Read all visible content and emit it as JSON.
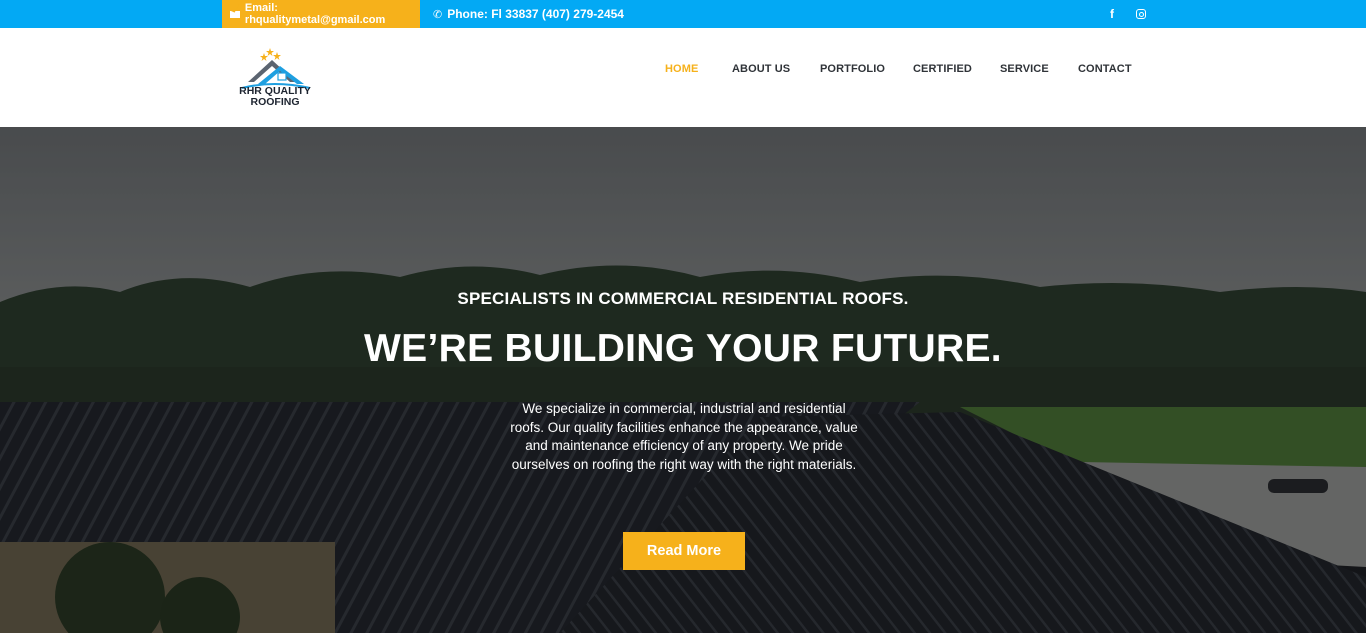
{
  "topbar": {
    "email_text": "Email: rhqualitymetal@gmail.com",
    "phone_text": "Phone: Fl 33837 (407) 279-2454",
    "email_icon": "envelope-icon",
    "phone_icon": "phone-icon",
    "social": [
      {
        "name": "facebook-icon",
        "glyph": "f"
      },
      {
        "name": "instagram-icon",
        "glyph": ""
      }
    ],
    "colors": {
      "bar": "#03a9f4",
      "email_bg": "#f6b11b"
    }
  },
  "header": {
    "logo_line1": "RHR QUALITY",
    "logo_line2": "ROOFING",
    "nav": [
      {
        "label": "HOME",
        "active": true
      },
      {
        "label": "ABOUT US",
        "active": false
      },
      {
        "label": "PORTFOLIO",
        "active": false
      },
      {
        "label": "CERTIFIED",
        "active": false
      },
      {
        "label": "SERVICE",
        "active": false
      },
      {
        "label": "CONTACT",
        "active": false
      }
    ],
    "colors": {
      "active": "#f6b11b",
      "default": "#2f3338"
    }
  },
  "hero": {
    "tagline": "SPECIALISTS IN COMMERCIAL RESIDENTIAL ROOFS.",
    "headline": "WE’RE BUILDING YOUR FUTURE.",
    "description": "We specialize in commercial, industrial and residential roofs. Our quality facilities enhance the appearance, value and maintenance efficiency of any property. We pride ourselves on roofing the right way with the right materials.",
    "button_label": "Read More",
    "colors": {
      "button": "#f6b11b"
    }
  }
}
